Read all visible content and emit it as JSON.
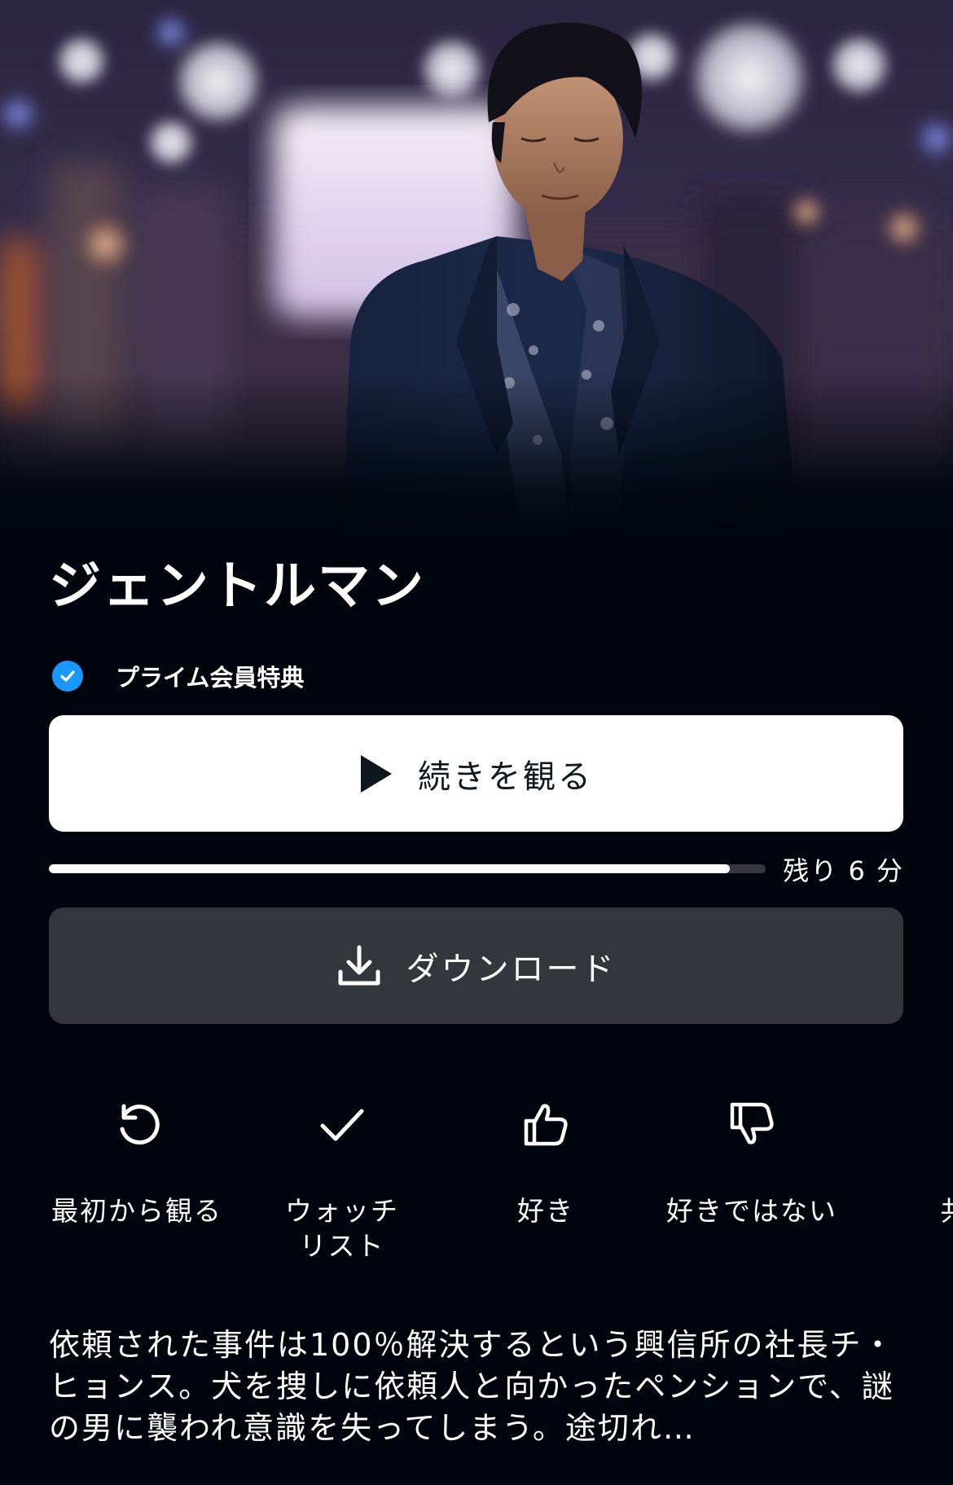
{
  "title": "ジェントルマン",
  "badge": {
    "label": "プライム会員特典",
    "icon": "check-circle-icon",
    "color": "#1a98ff"
  },
  "primary_button": {
    "label": "続きを観る",
    "icon": "play-icon"
  },
  "progress": {
    "watched_fraction": 0.95,
    "remaining_label": "残り 6 分"
  },
  "download_button": {
    "label": "ダウンロード",
    "icon": "download-icon"
  },
  "actions": [
    {
      "label": "最初から観る",
      "icon": "restart-icon"
    },
    {
      "label": "ウォッチ\nリスト",
      "icon": "checkmark-icon"
    },
    {
      "label": "好き",
      "icon": "thumbs-up-icon"
    },
    {
      "label": "好きではない",
      "icon": "thumbs-down-icon"
    },
    {
      "label": "共",
      "icon": "share-icon"
    }
  ],
  "description": "依頼された事件は100％解決するという興信所の社長チ・ヒョンス。犬を捜しに依頼人と向かったペンションで、謎の男に襲われ意識を失ってしまう。途切れ…",
  "colors": {
    "background": "#00050d",
    "primary_button_bg": "#ffffff",
    "secondary_button_bg": "#33373d",
    "accent": "#1a98ff"
  }
}
